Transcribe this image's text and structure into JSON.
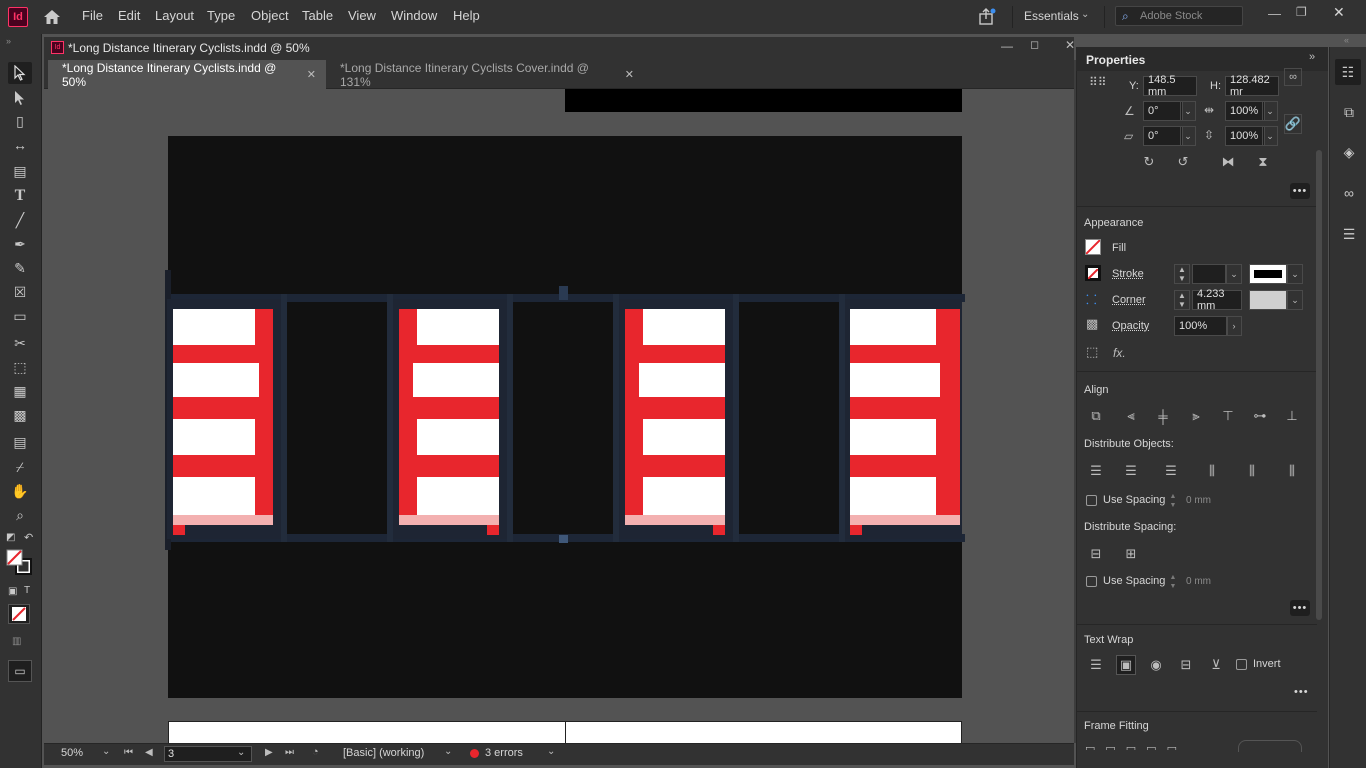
{
  "app": {
    "logo": "Id",
    "accent": "#ff3366"
  },
  "menu": [
    "File",
    "Edit",
    "Layout",
    "Type",
    "Object",
    "Table",
    "View",
    "Window",
    "Help"
  ],
  "workspace": "Essentials",
  "search": {
    "placeholder": "Adobe Stock"
  },
  "document": {
    "window_title": "*Long Distance Itinerary Cyclists.indd @ 50%",
    "tabs": [
      {
        "label": "*Long Distance Itinerary Cyclists.indd @ 50%",
        "active": true
      },
      {
        "label": "*Long Distance Itinerary Cyclists Cover.indd @ 131%",
        "active": false
      }
    ]
  },
  "status": {
    "zoom": "50%",
    "page": "3",
    "preflight_profile": "[Basic] (working)",
    "errors": "3 errors"
  },
  "properties": {
    "title": "Properties",
    "transform": {
      "y_label": "Y:",
      "y_value": "148.5 mm",
      "h_label": "H:",
      "h_value": "128.482 mr",
      "rotate_value": "0°",
      "scale_x_value": "100%",
      "shear_value": "0°",
      "scale_y_value": "100%"
    },
    "appearance": {
      "title": "Appearance",
      "fill_label": "Fill",
      "stroke_label": "Stroke",
      "corner_label": "Corner",
      "corner_value": "4.233 mm",
      "opacity_label": "Opacity",
      "opacity_value": "100%",
      "fx_label": "fx."
    },
    "align": {
      "title": "Align",
      "distribute_objects": "Distribute Objects:",
      "use_spacing": "Use Spacing",
      "spacing_value": "0 mm",
      "distribute_spacing": "Distribute Spacing:",
      "use_spacing_2": "Use Spacing",
      "spacing_value_2": "0 mm"
    },
    "text_wrap": {
      "title": "Text Wrap",
      "invert": "Invert"
    },
    "frame_fitting": {
      "title": "Frame Fitting"
    }
  }
}
